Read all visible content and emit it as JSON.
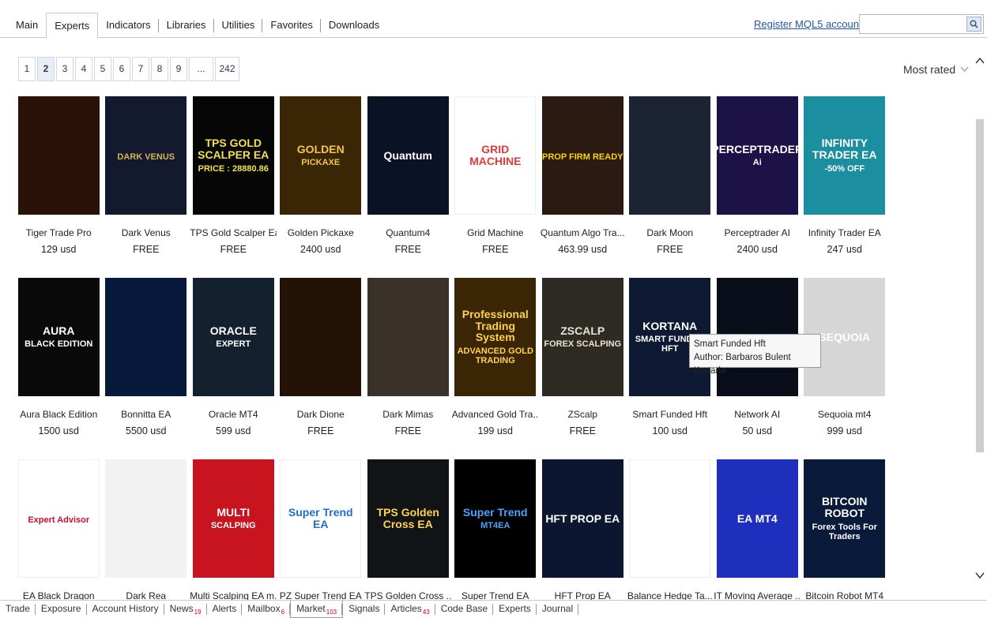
{
  "top_tabs": [
    {
      "label": "Main",
      "active": false
    },
    {
      "label": "Experts",
      "active": true
    },
    {
      "label": "Indicators",
      "active": false
    },
    {
      "label": "Libraries",
      "active": false
    },
    {
      "label": "Utilities",
      "active": false
    },
    {
      "label": "Favorites",
      "active": false
    },
    {
      "label": "Downloads",
      "active": false
    }
  ],
  "register_link": "Register MQL5 account",
  "search": {
    "value": "",
    "icon": "search-icon"
  },
  "pagination": {
    "pages": [
      "1",
      "2",
      "3",
      "4",
      "5",
      "6",
      "7",
      "8",
      "9",
      "...",
      "242"
    ],
    "current": "2"
  },
  "sort": {
    "value": "Most rated"
  },
  "products": [
    {
      "name": "Tiger Trade Pro",
      "price": "129 usd",
      "bg": "#2a1208",
      "fg": "#ff7a1a",
      "t1": "",
      "t2": ""
    },
    {
      "name": "Dark Venus",
      "price": "FREE",
      "bg": "#141a2e",
      "fg": "#d9b25a",
      "t1": "",
      "t2": "DARK VENUS"
    },
    {
      "name": "TPS Gold Scalper Ea",
      "price": "FREE",
      "bg": "#050505",
      "fg": "#f2e14a",
      "t1": "TPS GOLD SCALPER EA",
      "t2": "PRICE : 28880.86"
    },
    {
      "name": "Golden Pickaxe",
      "price": "2400 usd",
      "bg": "#3a2504",
      "fg": "#f3c64a",
      "t1": "GOLDEN",
      "t2": "PICKAXE"
    },
    {
      "name": "Quantum4",
      "price": "FREE",
      "bg": "#0a1326",
      "fg": "#ffffff",
      "t1": "Quantum",
      "t2": ""
    },
    {
      "name": "Grid Machine",
      "price": "FREE",
      "bg": "#ffffff",
      "fg": "#e23a3a",
      "t1": "GRID MACHINE",
      "t2": ""
    },
    {
      "name": "Quantum Algo Tra...",
      "price": "463.99 usd",
      "bg": "#2b1a12",
      "fg": "#ffd200",
      "t1": "",
      "t2": "PROP FIRM READY"
    },
    {
      "name": "Dark Moon",
      "price": "FREE",
      "bg": "#1c2333",
      "fg": "#c8d0dc",
      "t1": "",
      "t2": ""
    },
    {
      "name": "Perceptrader AI",
      "price": "2400 usd",
      "bg": "#1d1248",
      "fg": "#ffffff",
      "t1": "PERCEPTRADER",
      "t2": "Ai"
    },
    {
      "name": "Infinity Trader EA",
      "price": "247 usd",
      "bg": "#1b8fa0",
      "fg": "#ffffff",
      "t1": "INFINITY TRADER EA",
      "t2": "-50% OFF"
    },
    {
      "name": "Aura Black Edition",
      "price": "1500 usd",
      "bg": "#0a0a0a",
      "fg": "#ffffff",
      "t1": "AURA",
      "t2": "BLACK EDITION"
    },
    {
      "name": "Bonnitta EA",
      "price": "5500 usd",
      "bg": "#071a3c",
      "fg": "#6fb6ff",
      "t1": "",
      "t2": ""
    },
    {
      "name": "Oracle MT4",
      "price": "599 usd",
      "bg": "#13202e",
      "fg": "#ffffff",
      "t1": "ORACLE",
      "t2": "EXPERT"
    },
    {
      "name": "Dark Dione",
      "price": "FREE",
      "bg": "#241207",
      "fg": "#f0a040",
      "t1": "",
      "t2": ""
    },
    {
      "name": "Dark Mimas",
      "price": "FREE",
      "bg": "#3a3128",
      "fg": "#e6d3b0",
      "t1": "",
      "t2": ""
    },
    {
      "name": "Advanced Gold Tra...",
      "price": "199 usd",
      "bg": "#3a2605",
      "fg": "#ffd24a",
      "t1": "Professional Trading System",
      "t2": "ADVANCED GOLD TRADING"
    },
    {
      "name": "ZScalp",
      "price": "FREE",
      "bg": "#2e2a24",
      "fg": "#e9e3d4",
      "t1": "ZSCALP",
      "t2": "FOREX SCALPING"
    },
    {
      "name": "Smart Funded Hft",
      "price": "100 usd",
      "bg": "#0e1a33",
      "fg": "#ffffff",
      "t1": "KORTANA",
      "t2": "SMART FUNDED HFT"
    },
    {
      "name": "Network AI",
      "price": "50 usd",
      "bg": "#0a0e1a",
      "fg": "#ff9a2a",
      "t1": "",
      "t2": ""
    },
    {
      "name": "Sequoia mt4",
      "price": "999 usd",
      "bg": "#d6d6d6",
      "fg": "#ffffff",
      "t1": "SEQUOIA",
      "t2": ""
    },
    {
      "name": "EA Black Dragon",
      "price": "",
      "bg": "#ffffff",
      "fg": "#c8102e",
      "t1": "",
      "t2": "Expert Advisor"
    },
    {
      "name": "Dark Rea",
      "price": "",
      "bg": "#f2f2f2",
      "fg": "#555555",
      "t1": "",
      "t2": ""
    },
    {
      "name": "Multi Scalping EA m...",
      "price": "",
      "bg": "#c8141e",
      "fg": "#ffffff",
      "t1": "MULTI",
      "t2": "SCALPING"
    },
    {
      "name": "PZ Super Trend EA",
      "price": "",
      "bg": "#ffffff",
      "fg": "#1f6fc4",
      "t1": "Super Trend EA",
      "t2": ""
    },
    {
      "name": "TPS Golden Cross ...",
      "price": "",
      "bg": "#101417",
      "fg": "#ffd24a",
      "t1": "TPS Golden Cross EA",
      "t2": ""
    },
    {
      "name": "Super Trend EA",
      "price": "",
      "bg": "#000000",
      "fg": "#4aa3ff",
      "t1": "Super Trend",
      "t2": "MT4EA"
    },
    {
      "name": "HFT Prop EA",
      "price": "",
      "bg": "#0c1630",
      "fg": "#ffffff",
      "t1": "HFT PROP EA",
      "t2": ""
    },
    {
      "name": "Balance Hedge Ta...",
      "price": "",
      "bg": "#ffffff",
      "fg": "#f0b90b",
      "t1": "",
      "t2": ""
    },
    {
      "name": "IT Moving Average ...",
      "price": "",
      "bg": "#1f2fbd",
      "fg": "#ffffff",
      "t1": "EA MT4",
      "t2": ""
    },
    {
      "name": "Bitcoin Robot MT4",
      "price": "",
      "bg": "#0a1a3a",
      "fg": "#ffffff",
      "t1": "BITCOIN ROBOT",
      "t2": "Forex Tools For Traders"
    }
  ],
  "tooltip": {
    "line1": "Smart Funded Hft",
    "line2": "Author: Barbaros Bulent Kortarla"
  },
  "bottom_tabs": [
    {
      "label": "Trade",
      "badge": ""
    },
    {
      "label": "Exposure",
      "badge": ""
    },
    {
      "label": "Account History",
      "badge": ""
    },
    {
      "label": "News",
      "badge": "19"
    },
    {
      "label": "Alerts",
      "badge": ""
    },
    {
      "label": "Mailbox",
      "badge": "6"
    },
    {
      "label": "Market",
      "badge": "103",
      "active": true
    },
    {
      "label": "Signals",
      "badge": ""
    },
    {
      "label": "Articles",
      "badge": "43"
    },
    {
      "label": "Code Base",
      "badge": ""
    },
    {
      "label": "Experts",
      "badge": ""
    },
    {
      "label": "Journal",
      "badge": ""
    }
  ]
}
